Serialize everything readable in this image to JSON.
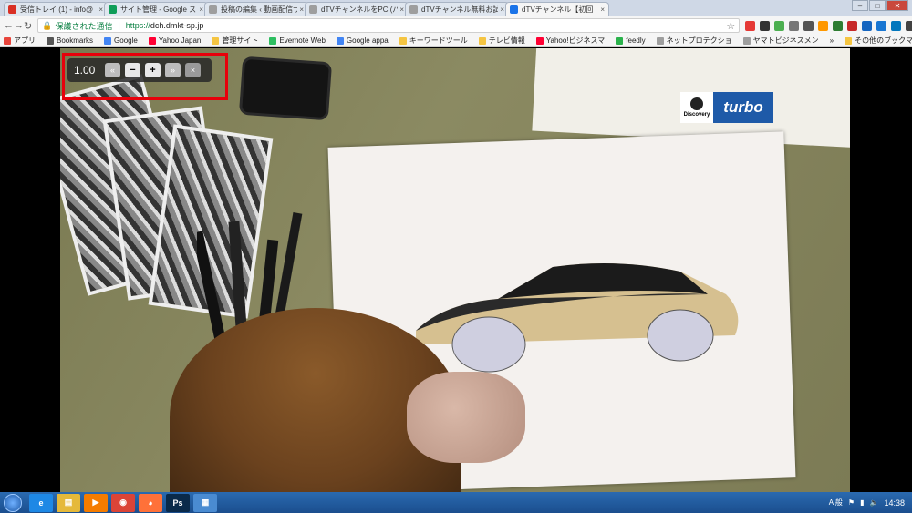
{
  "browser": {
    "tabs": [
      {
        "label": "受信トレイ (1) - info@",
        "icon_color": "#d93025",
        "icon": "gmail-icon",
        "active": false
      },
      {
        "label": "サイト管理 - Google ス",
        "icon_color": "#0f9d58",
        "icon": "sheets-icon",
        "active": false
      },
      {
        "label": "投稿の編集 ‹ 動画配信サ",
        "icon_color": "#9e9e9e",
        "icon": "page-icon",
        "active": false
      },
      {
        "label": "dTVチャンネルをPC (パ",
        "icon_color": "#9e9e9e",
        "icon": "page-icon",
        "active": false
      },
      {
        "label": "dTVチャンネル無料お試",
        "icon_color": "#9e9e9e",
        "icon": "page-icon",
        "active": false
      },
      {
        "label": "dTVチャンネル【初回",
        "icon_color": "#1a73e8",
        "icon": "dtv-icon",
        "active": true
      }
    ],
    "address": {
      "secure_label": "保護された通信",
      "scheme": "https://",
      "host": "dch.dmkt-sp.jp"
    },
    "bookmarks": [
      {
        "label": "アプリ",
        "icon": "apps-icon",
        "color": "#e8453c"
      },
      {
        "label": "Bookmarks",
        "icon": "star-icon",
        "color": "#555555"
      },
      {
        "label": "Google",
        "icon": "google-icon",
        "color": "#4285f4"
      },
      {
        "label": "Yahoo Japan",
        "icon": "yahoo-icon",
        "color": "#ff0033"
      },
      {
        "label": "管理サイト",
        "icon": "folder-icon",
        "color": "#f5c542"
      },
      {
        "label": "Evernote Web",
        "icon": "evernote-icon",
        "color": "#2dbe60"
      },
      {
        "label": "Google appa",
        "icon": "google-icon",
        "color": "#4285f4"
      },
      {
        "label": "キーワードツール",
        "icon": "folder-icon",
        "color": "#f5c542"
      },
      {
        "label": "テレビ情報",
        "icon": "folder-icon",
        "color": "#f5c542"
      },
      {
        "label": "Yahoo!ビジネスマ",
        "icon": "yahoo-icon",
        "color": "#ff0033"
      },
      {
        "label": "feedly",
        "icon": "feedly-icon",
        "color": "#2bb24c"
      },
      {
        "label": "ネットプロテクショ",
        "icon": "page-icon",
        "color": "#9e9e9e"
      },
      {
        "label": "ヤマトビジネスメン",
        "icon": "page-icon",
        "color": "#9e9e9e"
      }
    ],
    "bookmarks_overflow": "»",
    "other_bookmarks": "その他のブックマーク"
  },
  "player": {
    "speed_value": "1.00",
    "speed_buttons": {
      "slower_more": "«",
      "slower": "−",
      "faster": "+",
      "faster_more": "»",
      "close": "×"
    },
    "channel_logo": {
      "top": "Discovery",
      "name": "turbo",
      "color": "#1e5aa8"
    }
  },
  "taskbar": {
    "apps": [
      {
        "name": "ie-icon",
        "color": "#1e88e5",
        "glyph": "e"
      },
      {
        "name": "explorer-icon",
        "color": "#e5b93a",
        "glyph": "▤"
      },
      {
        "name": "media-player-icon",
        "color": "#f57c00",
        "glyph": "▶"
      },
      {
        "name": "chrome-icon",
        "color": "#db4437",
        "glyph": "◉"
      },
      {
        "name": "firefox-icon",
        "color": "#ff7139",
        "glyph": "◕"
      },
      {
        "name": "photoshop-icon",
        "color": "#0a2a4a",
        "glyph": "Ps"
      },
      {
        "name": "image-viewer-icon",
        "color": "#4a8bd1",
        "glyph": "▦"
      }
    ],
    "ime": "A 般",
    "clock": "14:38"
  }
}
